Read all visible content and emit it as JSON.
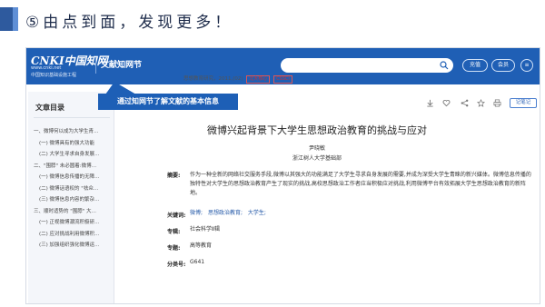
{
  "slide": {
    "title": "⑤由点到面，发现更多！",
    "accent_color": "#2e5a9e"
  },
  "topbar": {
    "logo_main": "CNKI中国知网",
    "logo_url": "www.cnki.net",
    "logo_sub": "中国知识基础设施工程",
    "nav_title": "文献知网节",
    "login_label": "充值",
    "member_label": "会员",
    "menu_icon": "menu-icon",
    "brand_color": "#1f5fb5"
  },
  "callout": {
    "text": "通过知网节了解文献的基本信息"
  },
  "sidebar": {
    "heading": "文章目录",
    "items": [
      {
        "text": "一、微博何以成为大学生青…",
        "indent": false
      },
      {
        "text": "(一) 微博具有的强大功能",
        "indent": true
      },
      {
        "text": "(二) 大学生寻求自身发展…",
        "indent": true
      },
      {
        "text": "二、\"围脖\" 未必圆着:微博…",
        "indent": false
      },
      {
        "text": "(一) 微博信息传播的无障…",
        "indent": true
      },
      {
        "text": "(二) 微博话语权的 \"祛众…",
        "indent": true
      },
      {
        "text": "(三) 微博信息内容的繁杂…",
        "indent": true
      },
      {
        "text": "三、顺时适势的 \"围脖\" 大…",
        "indent": false
      },
      {
        "text": "(一) 正视微博潮流积极研…",
        "indent": true
      },
      {
        "text": "(二) 应对挑战利用微博积…",
        "indent": true
      },
      {
        "text": "(三) 加强组织强化微博运…",
        "indent": true
      }
    ]
  },
  "article": {
    "meta": "思想教育研究，2011,(02)",
    "tags": [
      "北大核心",
      "CSSCI"
    ],
    "title": "微博兴起背景下大学生思想政治教育的挑战与应对",
    "author": "尹晓敏",
    "org": "浙江树人大学基础部",
    "abstract_label": "摘要:",
    "abstract": "作为一种全新的网络社交服务手段,微博以其强大的功能满足了大学生寻求自身发展的需要,并成为深受大学生青睐的新兴媒体。微博信息传播的独特性对大学生的思想政治教育产生了现实的挑战,高校思想政治工作者应当积极应对挑战,利用微博平台有效拓展大学生思想政治教育的新阵地。",
    "keywords_label": "关键词:",
    "keywords": [
      "微博;",
      "思想政治教育;",
      "大学生;"
    ],
    "series_label": "专辑:",
    "series": "社会科学Ⅱ辑",
    "topic_label": "专题:",
    "topic": "高等教育",
    "class_label": "分类号:",
    "class_no": "G641",
    "note_button": "记笔记",
    "toolbar_icons": [
      "download-icon",
      "favorite-icon",
      "share-icon",
      "star-icon",
      "print-icon"
    ]
  }
}
